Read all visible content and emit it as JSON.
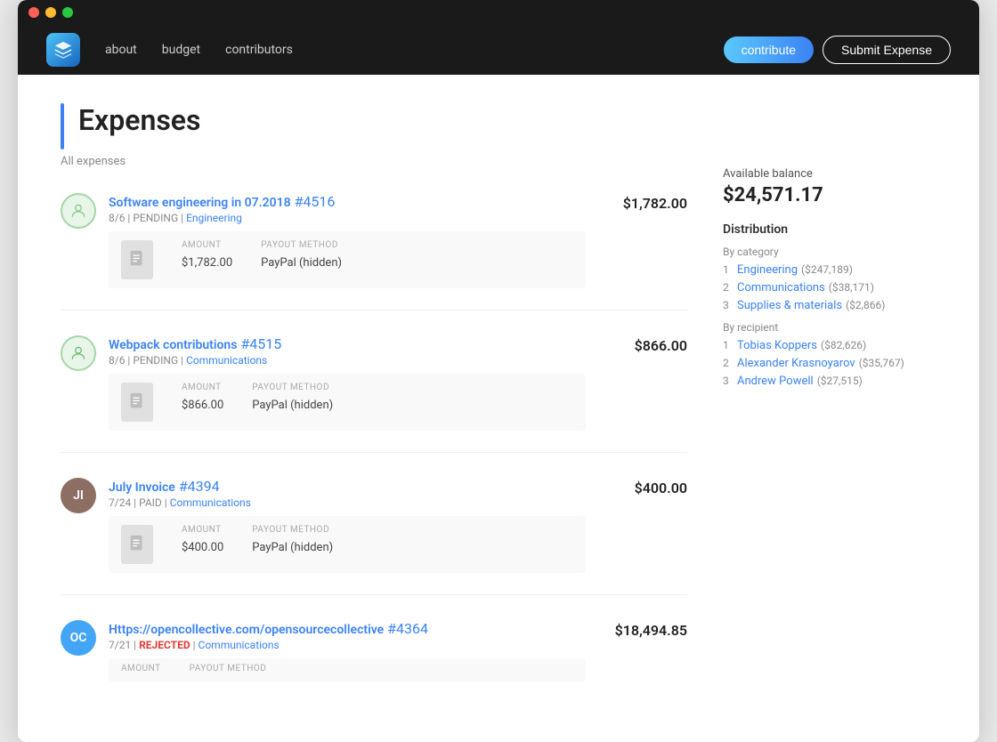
{
  "nav": {
    "links": [
      "about",
      "budget",
      "contributors"
    ],
    "btn_contribute": "contribute",
    "btn_submit": "Submit Expense"
  },
  "page": {
    "title": "Expenses",
    "subtitle": "All expenses"
  },
  "expenses": [
    {
      "id": "exp1",
      "title": "Software engineering in 07.2018",
      "number": "#4516",
      "meta_date": "8/6",
      "meta_status": "PENDING",
      "meta_status_type": "pending",
      "meta_category": "Engineering",
      "amount": "$1,782.00",
      "detail_amount": "$1,782.00",
      "detail_payout": "PayPal (hidden)",
      "avatar_type": "circle_green"
    },
    {
      "id": "exp2",
      "title": "Webpack contributions",
      "number": "#4515",
      "meta_date": "8/6",
      "meta_status": "PENDING",
      "meta_status_type": "pending",
      "meta_category": "Communications",
      "amount": "$866.00",
      "detail_amount": "$866.00",
      "detail_payout": "PayPal (hidden)",
      "avatar_type": "circle_green2"
    },
    {
      "id": "exp3",
      "title": "July Invoice",
      "number": "#4394",
      "meta_date": "7/24",
      "meta_status": "PAID",
      "meta_status_type": "paid",
      "meta_category": "Communications",
      "amount": "$400.00",
      "detail_amount": "$400.00",
      "detail_payout": "PayPal (hidden)",
      "avatar_type": "person_brown"
    },
    {
      "id": "exp4",
      "title": "Https://opencollective.com/opensourcecollective",
      "number": "#4364",
      "meta_date": "7/21",
      "meta_status": "REJECTED",
      "meta_status_type": "rejected",
      "meta_category": "Communications",
      "amount": "$18,494.85",
      "detail_amount": "",
      "detail_payout": "",
      "avatar_type": "person_blue"
    }
  ],
  "sidebar": {
    "balance_label": "Available balance",
    "balance_value": "$24,571.17",
    "distribution_label": "Distribution",
    "by_category_label": "By category",
    "categories": [
      {
        "rank": "1",
        "name": "Engineering",
        "amount": "($247,189)"
      },
      {
        "rank": "2",
        "name": "Communications",
        "amount": "($38,171)"
      },
      {
        "rank": "3",
        "name": "Supplies & materials",
        "amount": "($2,866)"
      }
    ],
    "by_recipient_label": "By recipient",
    "recipients": [
      {
        "rank": "1",
        "name": "Tobias Koppers",
        "amount": "($82,626)"
      },
      {
        "rank": "2",
        "name": "Alexander Krasnoyarov",
        "amount": "($35,767)"
      },
      {
        "rank": "3",
        "name": "Andrew Powell",
        "amount": "($27,515)"
      }
    ]
  },
  "detail_headers": {
    "amount": "AMOUNT",
    "payout": "PAYOUT METHOD"
  }
}
